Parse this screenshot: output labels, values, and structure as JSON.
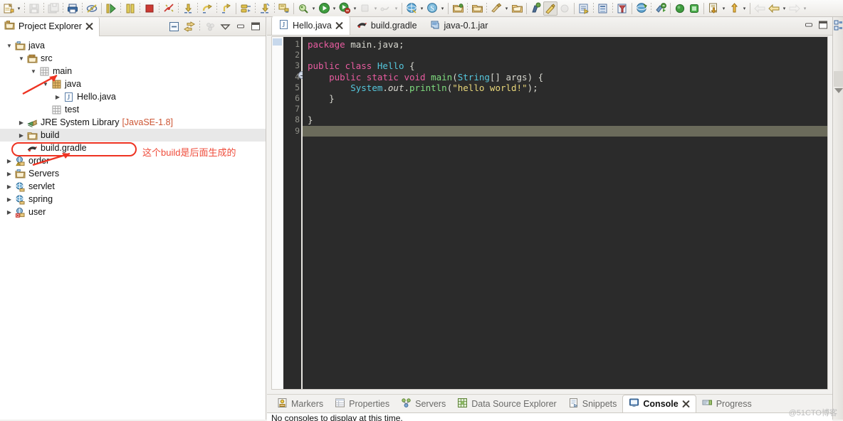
{
  "toolbar": {
    "groups": [
      {
        "items": [
          {
            "name": "new-wizard-icon",
            "label": "New",
            "menu": true,
            "kind": "new"
          },
          {
            "name": "save-icon",
            "label": "Save",
            "disabled": true,
            "kind": "save"
          },
          {
            "name": "save-all-icon",
            "label": "Save All",
            "disabled": true,
            "kind": "saveall"
          },
          {
            "name": "print-icon",
            "label": "Print",
            "kind": "print"
          },
          {
            "name": "toggle-mark-occurrences-icon",
            "label": "Toggle Mark Occurrences",
            "kind": "occur"
          }
        ]
      },
      {
        "items": [
          {
            "name": "resume-icon",
            "label": "Resume",
            "kind": "resume"
          },
          {
            "name": "suspend-icon",
            "label": "Suspend",
            "kind": "suspend"
          },
          {
            "name": "terminate-icon",
            "label": "Terminate",
            "kind": "terminate"
          },
          {
            "name": "disconnect-icon",
            "label": "Disconnect",
            "kind": "disconnect"
          },
          {
            "name": "step-into-icon",
            "label": "Step Into",
            "kind": "stepinto"
          },
          {
            "name": "step-over-icon",
            "label": "Step Over",
            "kind": "stepover"
          },
          {
            "name": "step-return-icon",
            "label": "Step Return",
            "kind": "stepreturn"
          }
        ]
      },
      {
        "items": [
          {
            "name": "drop-to-frame-icon",
            "label": "Drop to Frame",
            "kind": "drop"
          },
          {
            "name": "use-step-filters-icon",
            "label": "Use Step Filters",
            "kind": "filters"
          },
          {
            "name": "skip-breakpoints-icon",
            "label": "Skip All Breakpoints",
            "kind": "skipbp"
          }
        ]
      },
      {
        "items": [
          {
            "name": "open-type-icon",
            "label": "Open Type",
            "kind": "opentype"
          },
          {
            "name": "debug-icon",
            "label": "Debug",
            "menu": true,
            "kind": "debug"
          },
          {
            "name": "run-icon",
            "label": "Run",
            "menu": true,
            "kind": "run"
          },
          {
            "name": "coverage-icon",
            "label": "Coverage",
            "menu": true,
            "kind": "coverage"
          },
          {
            "name": "external-tools-icon",
            "label": "External Tools",
            "disabled": true,
            "menu": true,
            "kind": "ext"
          },
          {
            "name": "run-ant-icon",
            "label": "Run Ant Build",
            "disabled": true,
            "menu": true,
            "kind": "ant"
          }
        ]
      },
      {
        "items": [
          {
            "name": "open-web-browser-icon",
            "label": "Open Web Browser",
            "menu": true,
            "kind": "browser"
          },
          {
            "name": "search-icon",
            "label": "Search",
            "menu": true,
            "kind": "search"
          }
        ]
      },
      {
        "items": [
          {
            "name": "new-java-project-icon",
            "label": "New Java Project",
            "kind": "javaproj"
          },
          {
            "name": "new-package-icon",
            "label": "New Java Package",
            "kind": "pkg"
          },
          {
            "name": "new-class-icon",
            "label": "New Java Class",
            "menu": true,
            "kind": "class"
          },
          {
            "name": "new-source-folder-icon",
            "label": "New Source Folder",
            "kind": "srcfolder"
          }
        ]
      },
      {
        "items": [
          {
            "name": "new-annotation-icon",
            "label": "New Annotation",
            "kind": "annot"
          },
          {
            "name": "new-enum-icon",
            "label": "New Enum",
            "pressed": true,
            "kind": "enum"
          },
          {
            "name": "new-interface-icon",
            "label": "New Interface",
            "disabled": true,
            "kind": "iface"
          }
        ]
      },
      {
        "items": [
          {
            "name": "new-jsp-icon",
            "label": "New JSP File",
            "kind": "jsp"
          },
          {
            "name": "new-servlet-icon",
            "label": "New Servlet",
            "kind": "servlet"
          },
          {
            "name": "new-filter-icon",
            "label": "New Filter",
            "kind": "filter2"
          }
        ]
      },
      {
        "items": [
          {
            "name": "publish-icon",
            "label": "Publish to Server",
            "kind": "publish"
          },
          {
            "name": "start-server-icon",
            "label": "Start Server",
            "kind": "startsrv"
          }
        ]
      },
      {
        "items": [
          {
            "name": "start-dot-icon",
            "label": "Start",
            "kind": "dotgreen"
          },
          {
            "name": "stop-dot-icon",
            "label": "Stop",
            "kind": "dotsquare"
          }
        ]
      },
      {
        "items": [
          {
            "name": "checkout-icon",
            "label": "Check Out",
            "menu": true,
            "kind": "checkout"
          },
          {
            "name": "commit-icon",
            "label": "Commit",
            "menu": true,
            "kind": "commit"
          }
        ]
      },
      {
        "items": [
          {
            "name": "back-icon",
            "label": "Back",
            "disabled": true,
            "kind": "back"
          },
          {
            "name": "previous-annotation-icon",
            "label": "Previous Annotation",
            "menu": true,
            "kind": "prevann"
          },
          {
            "name": "next-annotation-icon",
            "label": "Next Annotation",
            "disabled": true,
            "menu": true,
            "kind": "nextann"
          }
        ]
      }
    ]
  },
  "project_explorer": {
    "tab_label": "Project Explorer",
    "close_icon": "close-x-icon",
    "view_icon": "project-explorer-icon",
    "buttons": [
      {
        "name": "collapse-all-button",
        "label": "Collapse All",
        "kind": "collapse"
      },
      {
        "name": "link-with-editor-button",
        "label": "Link with Editor",
        "kind": "link"
      },
      {
        "name": "focus-on-active-task-button",
        "label": "Focus on Active Task",
        "kind": "focus",
        "disabled": true
      },
      {
        "name": "view-menu-button",
        "label": "View Menu",
        "kind": "menu"
      },
      {
        "name": "minimize-button",
        "label": "Minimize",
        "kind": "min"
      },
      {
        "name": "maximize-button",
        "label": "Maximize",
        "kind": "max"
      }
    ],
    "tree": [
      {
        "label": "java",
        "icon": "project-folder-icon",
        "indent": 0,
        "state": "open",
        "selected": false
      },
      {
        "label": "src",
        "icon": "source-folder-icon",
        "indent": 1,
        "state": "open",
        "selected": false
      },
      {
        "label": "main",
        "icon": "package-empty-icon",
        "indent": 2,
        "state": "open",
        "selected": false
      },
      {
        "label": "java",
        "icon": "package-icon",
        "indent": 3,
        "state": "open",
        "selected": false
      },
      {
        "label": "Hello.java",
        "icon": "java-file-icon",
        "indent": 4,
        "state": "closed",
        "selected": false
      },
      {
        "label": "test",
        "icon": "package-empty-icon",
        "indent": 3,
        "state": "none",
        "selected": false
      },
      {
        "label": "JRE System Library",
        "icon": "jre-library-icon",
        "indent": 1,
        "state": "closed",
        "selected": false,
        "suffix": "[JavaSE-1.8]"
      },
      {
        "label": "build",
        "icon": "folder-icon",
        "indent": 1,
        "state": "closed",
        "selected": true
      },
      {
        "label": "build.gradle",
        "icon": "gradle-file-icon",
        "indent": 1,
        "state": "none",
        "selected": false
      },
      {
        "label": "order",
        "icon": "project-warning-icon",
        "indent": 0,
        "state": "closed",
        "selected": false
      },
      {
        "label": "Servers",
        "icon": "project-folder-icon",
        "indent": 0,
        "state": "closed",
        "selected": false
      },
      {
        "label": "servlet",
        "icon": "project-web-icon",
        "indent": 0,
        "state": "closed",
        "selected": false
      },
      {
        "label": "spring",
        "icon": "project-web-icon",
        "indent": 0,
        "state": "closed",
        "selected": false
      },
      {
        "label": "user",
        "icon": "project-error-icon",
        "indent": 0,
        "state": "closed",
        "selected": false
      }
    ],
    "annotation": {
      "text": "这个build是后面生成的",
      "color": "#ef4b3a",
      "highlight_target": "build"
    }
  },
  "editor": {
    "tabs": [
      {
        "label": "Hello.java",
        "icon": "java-file-icon",
        "active": true,
        "closable": true
      },
      {
        "label": "build.gradle",
        "icon": "gradle-file-icon",
        "active": false,
        "closable": false
      },
      {
        "label": "java-0.1.jar",
        "icon": "jar-file-icon",
        "active": false,
        "closable": false
      }
    ],
    "window_buttons": [
      {
        "name": "editor-minimize-button",
        "label": "Minimize",
        "kind": "min"
      },
      {
        "name": "editor-maximize-button",
        "label": "Maximize",
        "kind": "max"
      }
    ],
    "line_numbers": [
      "1",
      "2",
      "3",
      "4",
      "5",
      "6",
      "7",
      "8",
      "9"
    ],
    "fold_marker_line": 4,
    "cursor_line": 9,
    "theme": {
      "background": "#2b2b2b",
      "gutter_background": "#2b2b2b",
      "keyword": "#e85ca0",
      "type": "#55c7dd",
      "string": "#e9d77a",
      "method": "#7fdd7f",
      "plain": "#d8d8d0",
      "cursor_line": "#6b6b5b"
    },
    "code_lines": [
      [
        {
          "t": "package ",
          "c": "k"
        },
        {
          "t": "main.java;",
          "c": "fl"
        }
      ],
      [],
      [
        {
          "t": "public class ",
          "c": "k"
        },
        {
          "t": "Hello",
          "c": "ty"
        },
        {
          "t": " {",
          "c": "fl"
        }
      ],
      [
        {
          "t": "    ",
          "c": "fl"
        },
        {
          "t": "public static void ",
          "c": "k"
        },
        {
          "t": "main",
          "c": "fn"
        },
        {
          "t": "(",
          "c": "fl"
        },
        {
          "t": "String",
          "c": "ty"
        },
        {
          "t": "[] args) {",
          "c": "fl"
        }
      ],
      [
        {
          "t": "        ",
          "c": "fl"
        },
        {
          "t": "System",
          "c": "ty"
        },
        {
          "t": ".",
          "c": "fl"
        },
        {
          "t": "out",
          "c": "it"
        },
        {
          "t": ".",
          "c": "fl"
        },
        {
          "t": "println",
          "c": "fn"
        },
        {
          "t": "(",
          "c": "fl"
        },
        {
          "t": "\"hello world!\"",
          "c": "st"
        },
        {
          "t": ");",
          "c": "fl"
        }
      ],
      [
        {
          "t": "    }",
          "c": "fl"
        }
      ],
      [],
      [
        {
          "t": "}",
          "c": "fl"
        }
      ],
      []
    ]
  },
  "bottom_panel": {
    "tabs": [
      {
        "label": "Markers",
        "icon": "markers-icon",
        "active": false
      },
      {
        "label": "Properties",
        "icon": "properties-icon",
        "active": false
      },
      {
        "label": "Servers",
        "icon": "servers-icon",
        "active": false
      },
      {
        "label": "Data Source Explorer",
        "icon": "data-source-icon",
        "active": false
      },
      {
        "label": "Snippets",
        "icon": "snippets-icon",
        "active": false
      },
      {
        "label": "Console",
        "icon": "console-icon",
        "active": true,
        "closable": true
      },
      {
        "label": "Progress",
        "icon": "progress-icon",
        "active": false
      }
    ],
    "console_message": "No consoles to display at this time."
  },
  "right_bar": {
    "items": [
      {
        "name": "outline-view-button",
        "label": "Outline",
        "kind": "outline"
      }
    ]
  },
  "watermark": "@51CTO博客"
}
